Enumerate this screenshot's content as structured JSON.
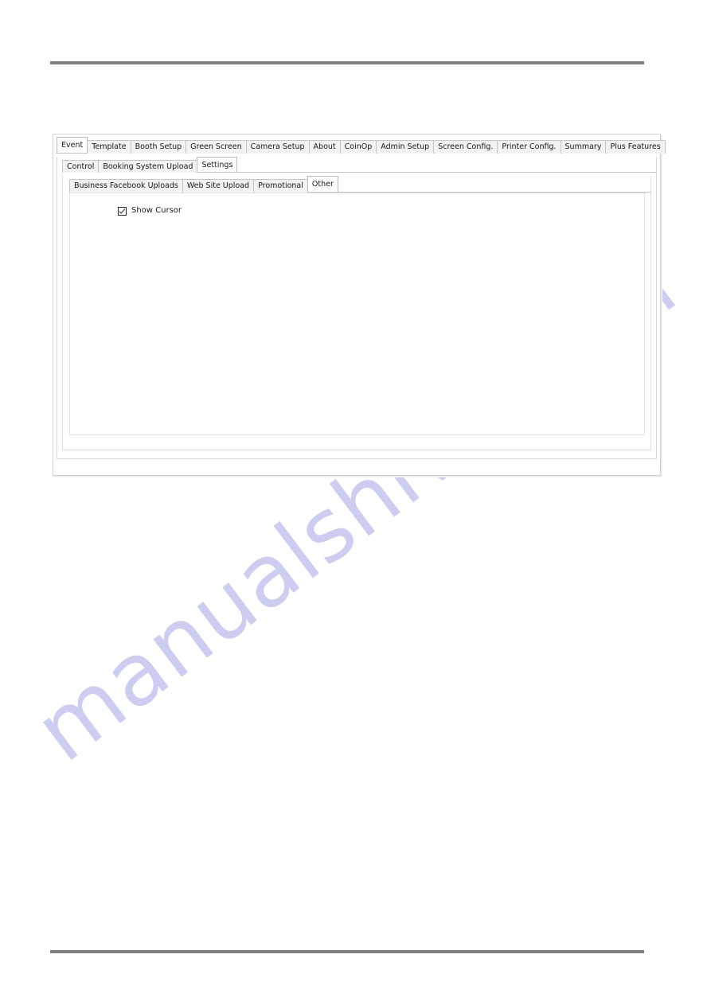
{
  "page": {
    "watermark_text": "manualshive.com",
    "watermark_color": "#cdcdf2",
    "rule_color": "#808084"
  },
  "app": {
    "tabs_level1": [
      {
        "label": "Event",
        "selected": true
      },
      {
        "label": "Template",
        "selected": false
      },
      {
        "label": "Booth Setup",
        "selected": false
      },
      {
        "label": "Green Screen",
        "selected": false
      },
      {
        "label": "Camera Setup",
        "selected": false
      },
      {
        "label": "About",
        "selected": false
      },
      {
        "label": "CoinOp",
        "selected": false
      },
      {
        "label": "Admin Setup",
        "selected": false
      },
      {
        "label": "Screen Config.",
        "selected": false
      },
      {
        "label": "Printer Config.",
        "selected": false
      },
      {
        "label": "Summary",
        "selected": false
      },
      {
        "label": "Plus Features",
        "selected": false
      }
    ],
    "tabs_level2": [
      {
        "label": "Control",
        "selected": false
      },
      {
        "label": "Booking System Upload",
        "selected": false
      },
      {
        "label": "Settings",
        "selected": true
      }
    ],
    "tabs_level3": [
      {
        "label": "Business Facebook Uploads",
        "selected": false
      },
      {
        "label": "Web Site Upload",
        "selected": false
      },
      {
        "label": "Promotional",
        "selected": false
      },
      {
        "label": "Other",
        "selected": true
      }
    ],
    "settings": {
      "show_cursor": {
        "label": "Show Cursor",
        "checked": true
      }
    }
  }
}
